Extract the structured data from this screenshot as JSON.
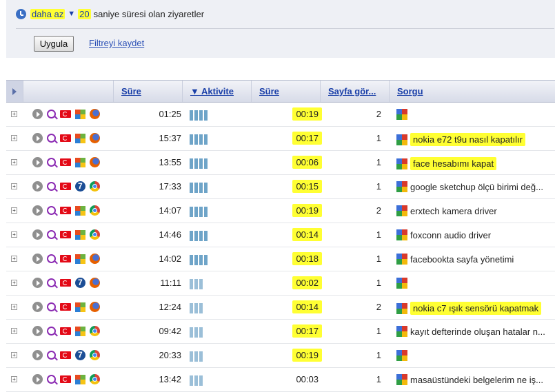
{
  "filter": {
    "condition": "daha az",
    "value": "20",
    "rest": "saniye süresi olan ziyaretler",
    "apply_label": "Uygula",
    "save_label": "Filtreyi kaydet"
  },
  "table": {
    "headers": {
      "duration": "Süre",
      "activity": "▼ Aktivite",
      "time": "Süre",
      "pageviews": "Sayfa gör...",
      "query": "Sorgu"
    },
    "rows": [
      {
        "os": "windows",
        "browser": "firefox",
        "duration": "01:25",
        "bars": 4,
        "time": "00:19",
        "time_hl": true,
        "views": "2",
        "query": "",
        "query_hl": false
      },
      {
        "os": "windows",
        "browser": "firefox",
        "duration": "15:37",
        "bars": 4,
        "time": "00:17",
        "time_hl": true,
        "views": "1",
        "query": "nokia e72 t9u nasıl kapatılır",
        "query_hl": true
      },
      {
        "os": "windows",
        "browser": "firefox",
        "duration": "13:55",
        "bars": 4,
        "time": "00:06",
        "time_hl": true,
        "views": "1",
        "query": "face hesabımı kapat",
        "query_hl": true
      },
      {
        "os": "win7",
        "browser": "chrome",
        "duration": "17:33",
        "bars": 4,
        "time": "00:15",
        "time_hl": true,
        "views": "1",
        "query": "google sketchup ölçü birimi değ...",
        "query_hl": false
      },
      {
        "os": "windows",
        "browser": "chrome",
        "duration": "14:07",
        "bars": 4,
        "time": "00:19",
        "time_hl": true,
        "views": "2",
        "query": "erxtech kamera driver",
        "query_hl": false
      },
      {
        "os": "windows",
        "browser": "chrome",
        "duration": "14:46",
        "bars": 4,
        "time": "00:14",
        "time_hl": true,
        "views": "1",
        "query": "foxconn audio driver",
        "query_hl": false
      },
      {
        "os": "windows",
        "browser": "firefox",
        "duration": "14:02",
        "bars": 4,
        "time": "00:18",
        "time_hl": true,
        "views": "1",
        "query": "facebookta sayfa yönetimi",
        "query_hl": false
      },
      {
        "os": "win7",
        "browser": "firefox",
        "duration": "11:11",
        "bars": 3,
        "time": "00:02",
        "time_hl": true,
        "views": "1",
        "query": "",
        "query_hl": false
      },
      {
        "os": "windows",
        "browser": "firefox",
        "duration": "12:24",
        "bars": 3,
        "time": "00:14",
        "time_hl": true,
        "views": "2",
        "query": "nokia c7 ışık sensörü kapatmak",
        "query_hl": true
      },
      {
        "os": "windows",
        "browser": "chrome",
        "duration": "09:42",
        "bars": 3,
        "time": "00:17",
        "time_hl": true,
        "views": "1",
        "query": "kayıt defterinde oluşan hatalar n...",
        "query_hl": false
      },
      {
        "os": "win7",
        "browser": "chrome",
        "duration": "20:33",
        "bars": 3,
        "time": "00:19",
        "time_hl": true,
        "views": "1",
        "query": "",
        "query_hl": false
      },
      {
        "os": "windows",
        "browser": "chrome",
        "duration": "13:42",
        "bars": 3,
        "time": "00:03",
        "time_hl": false,
        "views": "1",
        "query": "masaüstündeki belgelerim ne iş...",
        "query_hl": false
      }
    ]
  }
}
